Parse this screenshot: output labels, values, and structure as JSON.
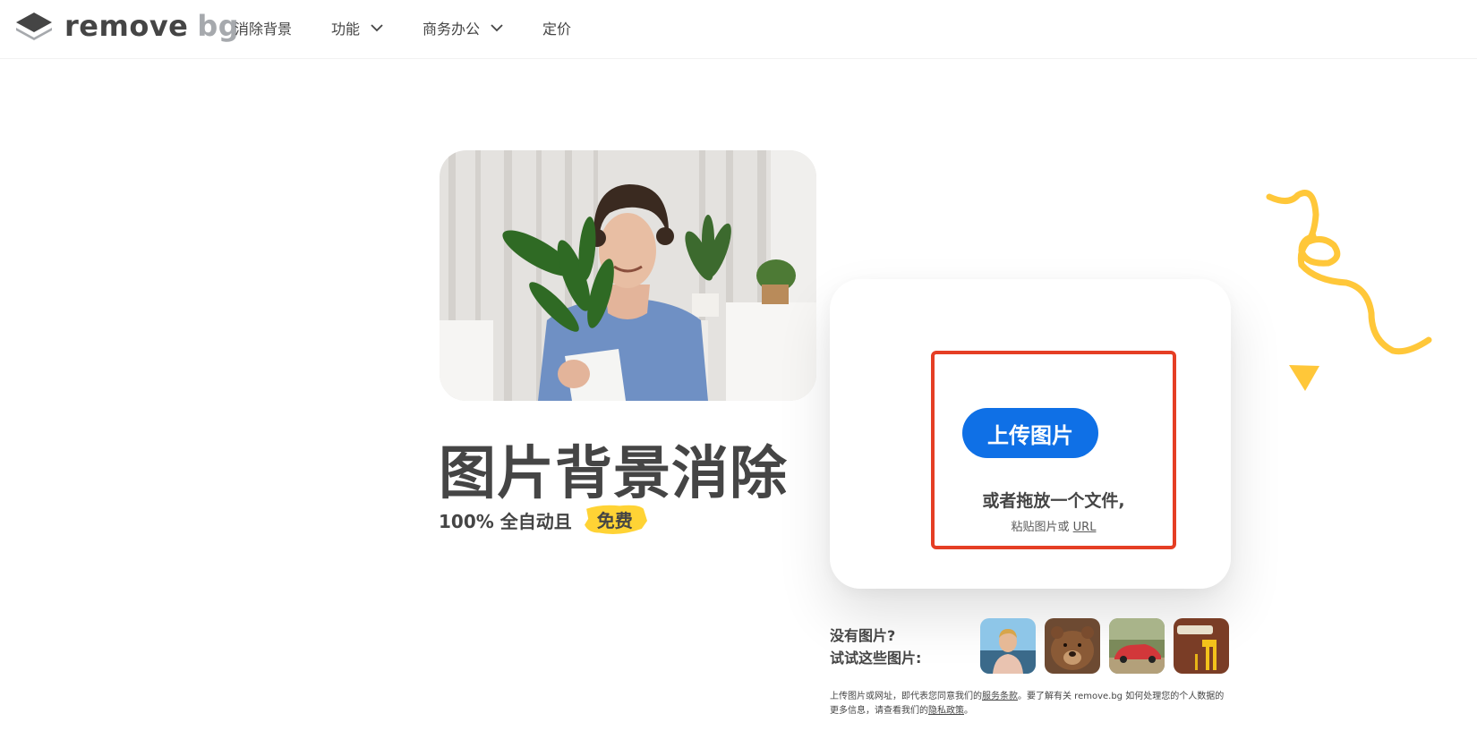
{
  "brand": {
    "logo_primary": "remove",
    "logo_secondary": "bg",
    "logo_icon": "layers-logo-icon",
    "colors": {
      "accent": "#0f70e6",
      "badge": "#ffd335",
      "highlight": "#e53e24",
      "text": "#454545"
    }
  },
  "nav": {
    "items": [
      {
        "label": "消除背景",
        "dropdown": false
      },
      {
        "label": "功能",
        "dropdown": true
      },
      {
        "label": "商务办公",
        "dropdown": true
      },
      {
        "label": "定价",
        "dropdown": false
      }
    ]
  },
  "hero": {
    "title": "图片背景消除",
    "subtitle": "100% 全自动且",
    "badge": "免费"
  },
  "upload": {
    "button_label": "上传图片",
    "drop_text": "或者拖放一个文件,",
    "paste_text": "粘贴图片或",
    "url_link": "URL"
  },
  "samples": {
    "label_line1": "没有图片?",
    "label_line2": "试试这些图片:",
    "items": [
      "person-sample",
      "bear-sample",
      "car-sample",
      "paint-roller-sample"
    ]
  },
  "terms": {
    "part1": "上传图片或网址，即代表您同意我们的",
    "terms_link": "服务条款",
    "part2": "。要了解有关 remove.bg 如何处理您的个人数据的更多信息，请查看我们的",
    "privacy_link": "隐私政策",
    "part3": "。"
  }
}
